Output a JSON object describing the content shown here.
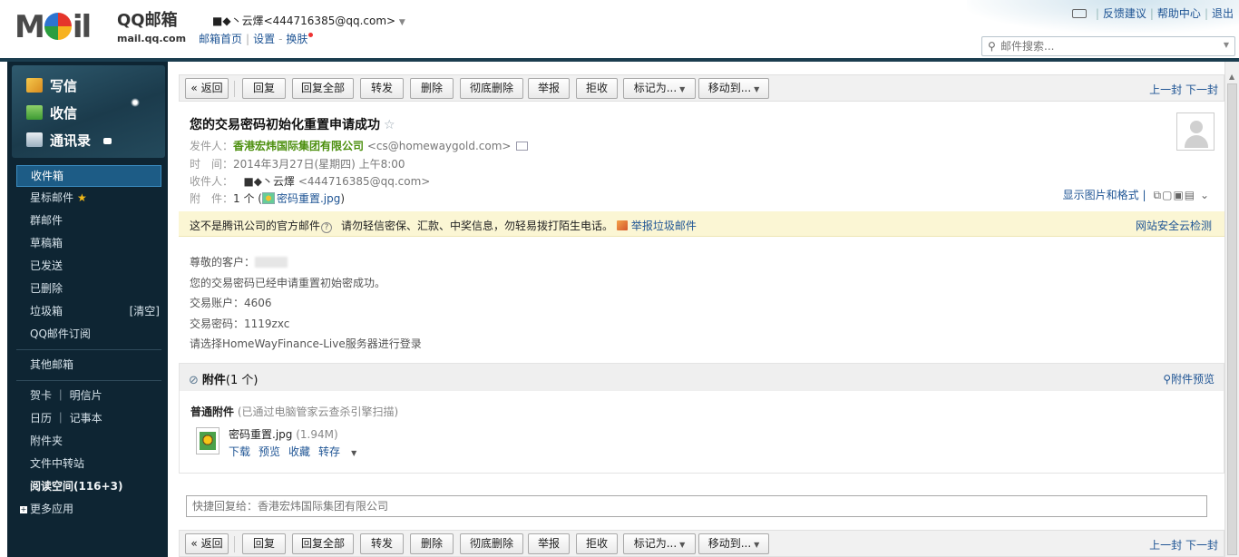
{
  "header": {
    "logo_text_m": "M",
    "logo_text_il": "il",
    "brand_cn": "QQ邮箱",
    "brand_url": "mail.qq.com",
    "user_display": "■◆丶云燡<444716385@qq.com>",
    "links": [
      "邮箱首页",
      "设置",
      "换肤"
    ],
    "right_links": [
      "反馈建议",
      "帮助中心",
      "退出"
    ],
    "search_placeholder": "邮件搜索..."
  },
  "sidebar": {
    "write": "写信",
    "receive": "收信",
    "contacts": "通讯录",
    "items": [
      "收件箱",
      "星标邮件",
      "群邮件",
      "草稿箱",
      "已发送",
      "已删除",
      "垃圾箱",
      "QQ邮件订阅"
    ],
    "trash_clear": "[清空]",
    "other_mailbox": "其他邮箱",
    "cards": "贺卡",
    "postcards": "明信片",
    "calendar": "日历",
    "notes": "记事本",
    "attachments": "附件夹",
    "file_transfer": "文件中转站",
    "reading_space": "阅读空间(116+3)",
    "more_apps": "更多应用"
  },
  "toolbar": {
    "back": "« 返回",
    "reply": "回复",
    "reply_all": "回复全部",
    "forward": "转发",
    "delete": "删除",
    "delete_perm": "彻底删除",
    "report": "举报",
    "reject": "拒收",
    "mark_as": "标记为...",
    "move_to": "移动到...",
    "prev": "上一封",
    "next": "下一封"
  },
  "mail": {
    "subject": "您的交易密码初始化重置申请成功",
    "from_label": "发件人：",
    "from_name": "香港宏炜国际集团有限公司",
    "from_addr": "<cs@homewaygold.com>",
    "time_label": "时　间：",
    "time": "2014年3月27日(星期四) 上午8:00",
    "to_label": "收件人：",
    "to_name": "■◆丶云燡",
    "to_addr": "<444716385@qq.com>",
    "att_label": "附　件：",
    "att_count": "1 个 (",
    "att_name": "密码重置.jpg",
    "att_close": ")",
    "display_format": "显示图片和格式",
    "warning": "这不是腾讯公司的官方邮件",
    "warning2": "请勿轻信密保、汇款、中奖信息，勿轻易拨打陌生电话。",
    "report_spam": "举报垃圾邮件",
    "cloud_check": "网站安全云检测",
    "body": {
      "greeting": "尊敬的客户：",
      "line1": "您的交易密码已经申请重置初始密成功。",
      "account": "交易账户：4606",
      "password": "交易密码：1119zxc",
      "line4": "请选择HomeWayFinance-Live服务器进行登录"
    }
  },
  "attachment_panel": {
    "title": "附件",
    "count": "(1 个)",
    "preview": "附件预览",
    "normal_label": "普通附件",
    "scan_note": "(已通过电脑管家云查杀引擎扫描)",
    "file_name": "密码重置.jpg",
    "file_size": "(1.94M)",
    "actions": [
      "下载",
      "预览",
      "收藏",
      "转存"
    ]
  },
  "quick_reply_placeholder": "快捷回复给：香港宏炜国际集团有限公司",
  "colors": {
    "sidebar_bg": "#0e2533",
    "link": "#1e5494",
    "sender_green": "#4c8f0e",
    "warning_bg": "#fbf6d4"
  }
}
